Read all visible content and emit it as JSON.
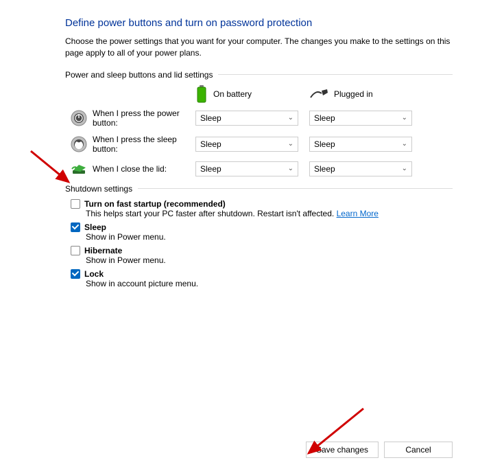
{
  "title": "Define power buttons and turn on password protection",
  "description": "Choose the power settings that you want for your computer. The changes you make to the settings on this page apply to all of your power plans.",
  "section_buttons": "Power and sleep buttons and lid settings",
  "columns": {
    "battery": "On battery",
    "plugged": "Plugged in"
  },
  "rows": {
    "power": {
      "label": "When I press the power button:",
      "battery": "Sleep",
      "plugged": "Sleep"
    },
    "sleep": {
      "label": "When I press the sleep button:",
      "battery": "Sleep",
      "plugged": "Sleep"
    },
    "lid": {
      "label": "When I close the lid:",
      "battery": "Sleep",
      "plugged": "Sleep"
    }
  },
  "section_shutdown": "Shutdown settings",
  "options": {
    "fast": {
      "title": "Turn on fast startup (recommended)",
      "desc_pre": "This helps start your PC faster after shutdown. Restart isn't affected. ",
      "link": "Learn More",
      "checked": false
    },
    "sleep": {
      "title": "Sleep",
      "desc": "Show in Power menu.",
      "checked": true
    },
    "hiber": {
      "title": "Hibernate",
      "desc": "Show in Power menu.",
      "checked": false
    },
    "lock": {
      "title": "Lock",
      "desc": "Show in account picture menu.",
      "checked": true
    }
  },
  "buttons": {
    "save": "Save changes",
    "cancel": "Cancel"
  }
}
